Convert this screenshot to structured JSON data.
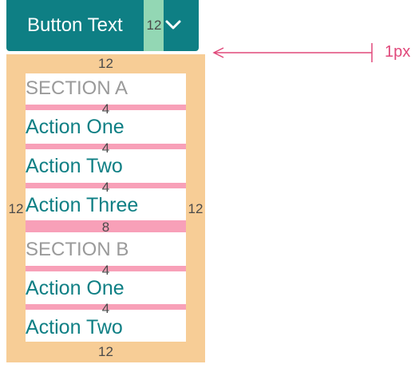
{
  "button": {
    "label": "Button Text",
    "gap_spec": "12",
    "icon": "chevron-down-icon",
    "color": "#0e7f84"
  },
  "menu": {
    "padding_color": "#f7cd96",
    "spacer_color": "#f8a0b8",
    "padding_top_spec": "12",
    "padding_left_spec": "12",
    "padding_right_spec": "12",
    "padding_bottom_spec": "12",
    "section_a": {
      "header": "SECTION A",
      "items": [
        "Action One",
        "Action Two",
        "Action Three"
      ],
      "spacers": [
        "4",
        "4",
        "4"
      ]
    },
    "section_gap_spec": "8",
    "section_b": {
      "header": "SECTION B",
      "items": [
        "Action One",
        "Action Two"
      ],
      "spacers": [
        "4",
        "4"
      ]
    }
  },
  "annotation": {
    "label": "1px",
    "color": "#e0487a"
  }
}
